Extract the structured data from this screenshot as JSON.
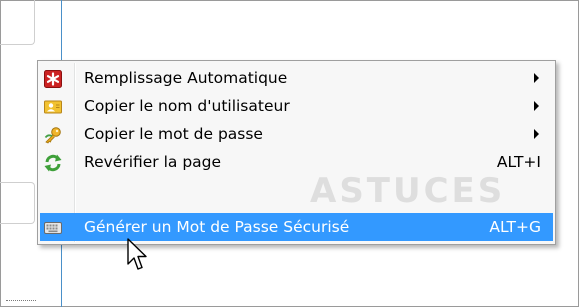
{
  "menu": {
    "items": [
      {
        "label": "Remplissage Automatique",
        "shortcut": "",
        "icon": "lastpass-star-icon",
        "has_submenu": true,
        "selected": false
      },
      {
        "label": "Copier le nom d'utilisateur",
        "shortcut": "",
        "icon": "user-card-icon",
        "has_submenu": true,
        "selected": false
      },
      {
        "label": "Copier le mot de passe",
        "shortcut": "",
        "icon": "key-password-icon",
        "has_submenu": true,
        "selected": false
      },
      {
        "label": "Revérifier la page",
        "shortcut": "ALT+I",
        "icon": "refresh-icon",
        "has_submenu": false,
        "selected": false
      },
      {
        "label": "Générer un Mot de Passe Sécurisé",
        "shortcut": "ALT+G",
        "icon": "keyboard-icon",
        "has_submenu": false,
        "selected": true
      }
    ]
  },
  "watermark": {
    "text": "ASTUCES"
  },
  "colors": {
    "selection": "#3399ff",
    "menu_bg": "#f7f7f7",
    "accent_line": "#4a90c9"
  }
}
